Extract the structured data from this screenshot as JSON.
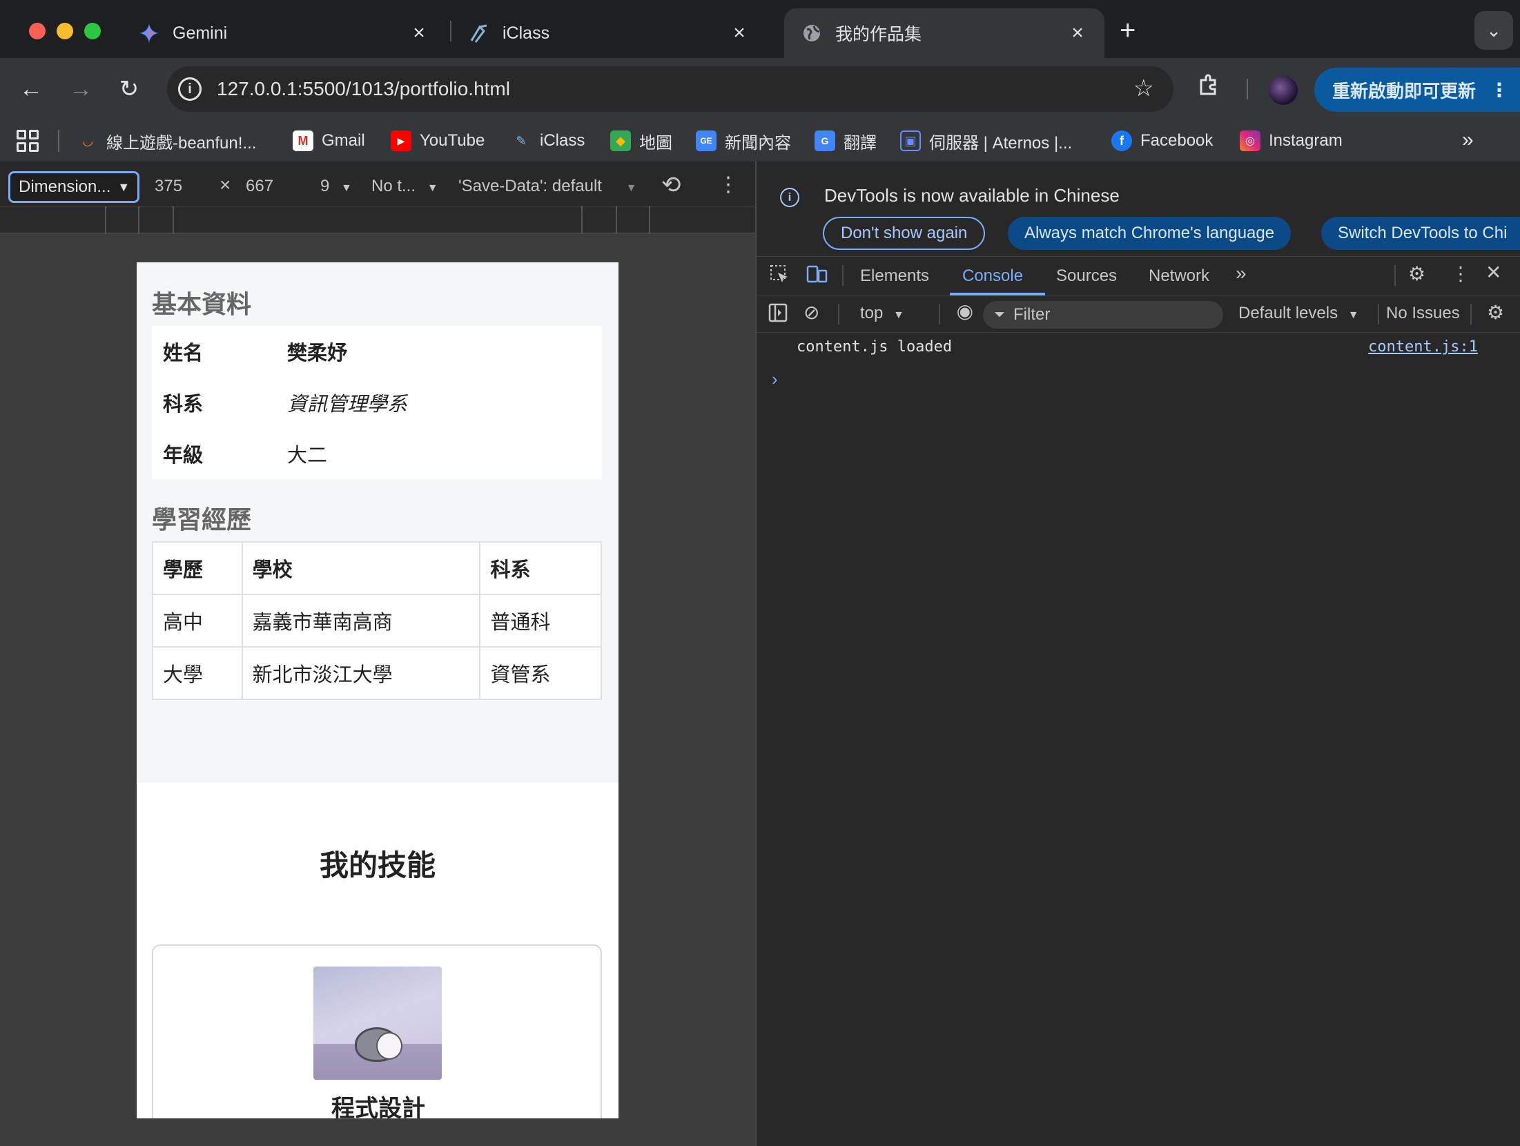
{
  "browser": {
    "tabs": [
      {
        "title": "Gemini",
        "icon": "gemini-icon"
      },
      {
        "title": "iClass",
        "icon": "iclass-icon"
      },
      {
        "title": "我的作品集",
        "icon": "globe-icon"
      }
    ],
    "url": "127.0.0.1:5500/1013/portfolio.html",
    "update_button": "重新啟動即可更新",
    "bookmarks": [
      {
        "label": "線上遊戲-beanfun!...",
        "icon": "beanfun-icon"
      },
      {
        "label": "Gmail",
        "icon": "gmail-icon"
      },
      {
        "label": "YouTube",
        "icon": "youtube-icon"
      },
      {
        "label": "iClass",
        "icon": "iclass-icon"
      },
      {
        "label": "地圖",
        "icon": "maps-icon"
      },
      {
        "label": "新聞內容",
        "icon": "news-icon"
      },
      {
        "label": "翻譯",
        "icon": "translate-icon"
      },
      {
        "label": "伺服器 | Aternos |...",
        "icon": "aternos-icon"
      },
      {
        "label": "Facebook",
        "icon": "facebook-icon"
      },
      {
        "label": "Instagram",
        "icon": "instagram-icon"
      }
    ]
  },
  "device_toolbar": {
    "dimension": "Dimension...",
    "width": "375",
    "times": "×",
    "height": "667",
    "zoom": "9",
    "throttle": "No t...",
    "save_data": "'Save-Data': default"
  },
  "portfolio": {
    "basic_title": "基本資料",
    "info_rows": [
      {
        "key": "姓名",
        "value": "樊柔妤"
      },
      {
        "key": "科系",
        "value": "資訊管理學系"
      },
      {
        "key": "年級",
        "value": "大二"
      }
    ],
    "edu_title": "學習經歷",
    "edu_headers": [
      "學歷",
      "學校",
      "科系"
    ],
    "edu_rows": [
      [
        "高中",
        "嘉義市華南高商",
        "普通科"
      ],
      [
        "大學",
        "新北市淡江大學",
        "資管系"
      ]
    ],
    "skills_title": "我的技能",
    "skill_name": "程式設計"
  },
  "devtools": {
    "banner_message": "DevTools is now available in Chinese",
    "banner_buttons": [
      "Don't show again",
      "Always match Chrome's language",
      "Switch DevTools to Chi"
    ],
    "tabs": [
      "Elements",
      "Console",
      "Sources",
      "Network"
    ],
    "active_tab": "Console",
    "context": "top",
    "filter_placeholder": "Filter",
    "levels": "Default levels",
    "issues": "No Issues",
    "log_message": "content.js loaded",
    "log_source": "content.js:1"
  },
  "colors": {
    "accent": "#7cacf8",
    "update_button_bg": "#0a5aa0",
    "page_bg": "#f5f6f8"
  }
}
